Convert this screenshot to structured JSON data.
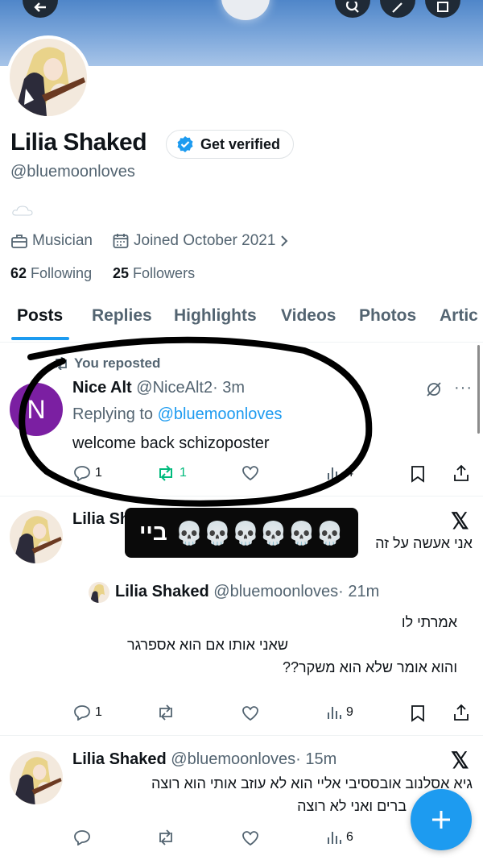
{
  "profile": {
    "name": "Lilia Shaked",
    "verify_label": "Get verified",
    "handle": "@bluemoonloves",
    "occupation": "Musician",
    "joined": "Joined October 2021",
    "following_count": "62",
    "following_label": "Following",
    "followers_count": "25",
    "followers_label": "Followers"
  },
  "tabs": [
    {
      "label": "Posts",
      "active": true
    },
    {
      "label": "Replies"
    },
    {
      "label": "Highlights"
    },
    {
      "label": "Videos"
    },
    {
      "label": "Photos"
    },
    {
      "label": "Artic"
    }
  ],
  "tweets": [
    {
      "repost_label": "You reposted",
      "avatar_letter": "N",
      "name": "Nice Alt",
      "handle": "@NiceAlt2",
      "time": "· 3m",
      "replying_prefix": "Replying to",
      "replying_handle": "@bluemoonloves",
      "text": "welcome back schizoposter",
      "replies": "1",
      "reposts": "1",
      "views": "4"
    },
    {
      "name": "Lilia Sh",
      "text_he": "אני אעשה על זה",
      "quote": {
        "name": "Lilia Shaked",
        "handle": "@bluemoonloves",
        "time": "· 21m",
        "line1": "אמרתי לו",
        "line2": "שאני אותו אם הוא אספרגר",
        "line3": "והוא אומר שלא הוא משקר??"
      },
      "replies": "1",
      "views": "9"
    },
    {
      "name": "Lilia Shaked",
      "handle": "@bluemoonloves",
      "time": "· 15m",
      "line1": "גיא אסלנוב אובססיבי אליי הוא לא עוזב אותי הוא רוצה",
      "line2": "ברים ואני לא רוצה",
      "views": "6"
    }
  ],
  "sticker": {
    "text": "ביי",
    "emoji": "💀💀💀💀💀💀"
  },
  "colors": {
    "accent": "#1d9bf0",
    "repost_green": "#00ba7c",
    "secondary_text": "#536471"
  },
  "icons": [
    "back-arrow-icon",
    "search-icon",
    "edit-icon",
    "more-icon",
    "verified-badge-icon",
    "briefcase-icon",
    "calendar-icon",
    "chevron-right-icon",
    "repost-icon",
    "grok-icon",
    "reply-icon",
    "like-icon",
    "views-icon",
    "bookmark-icon",
    "share-icon",
    "x-logo-icon",
    "plus-icon"
  ]
}
